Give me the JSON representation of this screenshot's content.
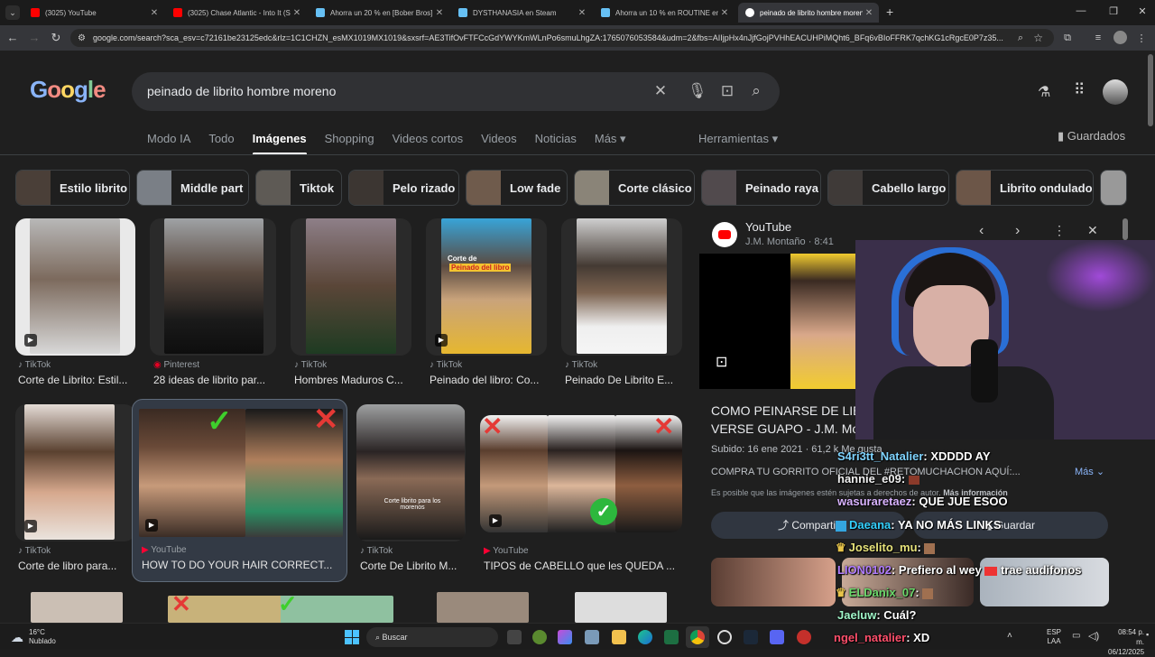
{
  "tabs": [
    {
      "title": "(3025) YouTube",
      "color": "#ff0000"
    },
    {
      "title": "(3025) Chase Atlantic - Into It (Sl...",
      "color": "#ff0000"
    },
    {
      "title": "Ahorra un 20 % en [Bober Bros]...",
      "color": "#1b2838"
    },
    {
      "title": "DYSTHANASIA en Steam",
      "color": "#1b2838"
    },
    {
      "title": "Ahorra un 10 % en ROUTINE en...",
      "color": "#1b2838"
    },
    {
      "title": "peinado de librito hombre moreno",
      "color": "#4285f4"
    }
  ],
  "url": "google.com/search?sca_esv=c72161be23125edc&rlz=1C1CHZN_esMX1019MX1019&sxsrf=AE3TifOvFTFCcGdYWYKmWLnPo6smuLhgZA:1765076053584&udm=2&fbs=AIIjpHx4nJjfGojPVHhEACUHPiMQht6_BFq6vBIoFFRK7qchKG1cRgcE0P7z35...",
  "google": {
    "logo": "Google",
    "query": "peinado de librito hombre moreno",
    "filters": [
      "Modo IA",
      "Todo",
      "Imágenes",
      "Shopping",
      "Videos cortos",
      "Videos",
      "Noticias",
      "Más ▾"
    ],
    "tools": "Herramientas ▾",
    "saved": "Guardados",
    "chips": [
      "Estilo librito",
      "Middle part",
      "Tiktok",
      "Pelo rizado",
      "Low fade",
      "Corte clásico",
      "Peinado raya",
      "Cabello largo",
      "Librito ondulado"
    ],
    "row1": [
      {
        "source": "TikTok",
        "caption": "Corte de Librito: Estil..."
      },
      {
        "source": "Pinterest",
        "caption": "28 ideas de librito par..."
      },
      {
        "source": "TikTok",
        "caption": "Hombres Maduros C..."
      },
      {
        "source": "TikTok",
        "caption": "Peinado del libro: Co..."
      },
      {
        "source": "TikTok",
        "caption": "Peinado De Librito E..."
      }
    ],
    "row2": [
      {
        "source": "TikTok",
        "caption": "Corte de libro para..."
      },
      {
        "source": "YouTube",
        "caption": "HOW TO DO YOUR HAIR CORRECT..."
      },
      {
        "source": "TikTok",
        "caption": "Corte De Librito M..."
      },
      {
        "source": "YouTube",
        "caption": "TIPOS de CABELLO que les QUEDA ..."
      }
    ],
    "overlay_texts": {
      "t1": "Corte de",
      "t2": "Peinado del libro",
      "t3": "Corte librito para los morenos"
    }
  },
  "panel": {
    "site": "YouTube",
    "author": "J.M. Montaño · 8:41",
    "title_line1": "COMO PEINARSE DE LIE",
    "title_line2": "VERSE GUAPO - J.M. Mo",
    "date": "Subido: 16 ene 2021 · 61,2 k Me gusta",
    "desc": "COMPRA TU GORRITO OFICIAL DEL #RETOMUCHACHON AQUÍ:...",
    "more": "Más ⌄",
    "copyright": "Es posible que las imágenes estén sujetas a derechos de autor.",
    "more_info": "Más información",
    "share": "Compartir",
    "save": "Guardar"
  },
  "chat": [
    {
      "user": "S4ri3tt_Natalier",
      "msg": ": XDDDD AY",
      "color": "#7fd4ff"
    },
    {
      "user": "hannie_e09",
      "msg": ":",
      "color": "#f0f0f0"
    },
    {
      "user": "wasuraretaez",
      "msg": ": QUE JUE ESOO",
      "color": "#d9b3ff"
    },
    {
      "user": "Daeana",
      "msg": ": YA NO MÁS LINKS",
      "color": "#34d1ff"
    },
    {
      "user": "Joselito_mu",
      "msg": ":",
      "color": "#e6e27a"
    },
    {
      "user": "LION0102",
      "msg": ": Prefiero al wey",
      "msg2": "trae audifonos",
      "color": "#b07cff"
    },
    {
      "user": "ELDanix_07",
      "msg": ":",
      "color": "#6bd86b"
    },
    {
      "user": "Jaeluw",
      "msg": ": Cuál?",
      "color": "#9ff5c8"
    },
    {
      "user": "ngel_natalier",
      "msg": ": XD",
      "color": "#ff4f6b"
    }
  ],
  "taskbar": {
    "weather_temp": "16°C",
    "weather_desc": "Nublado",
    "search": "Buscar",
    "lang1": "ESP",
    "lang2": "LAA",
    "time": "08:54 p. m.",
    "date": "06/12/2025"
  }
}
